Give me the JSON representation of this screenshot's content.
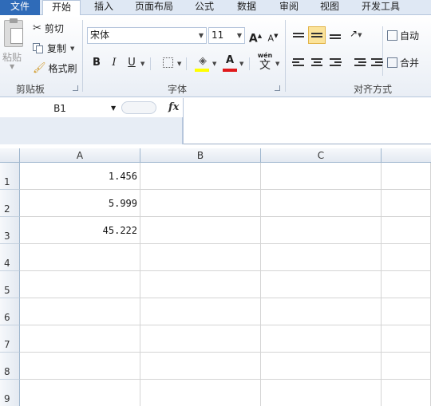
{
  "tabs": [
    {
      "label": "文件",
      "active": false
    },
    {
      "label": "开始",
      "active": true
    },
    {
      "label": "插入",
      "active": false
    },
    {
      "label": "页面布局",
      "active": false
    },
    {
      "label": "公式",
      "active": false
    },
    {
      "label": "数据",
      "active": false
    },
    {
      "label": "审阅",
      "active": false
    },
    {
      "label": "视图",
      "active": false
    },
    {
      "label": "开发工具",
      "active": false
    }
  ],
  "clipboard": {
    "paste_label": "粘贴",
    "cut_label": "剪切",
    "copy_label": "复制",
    "format_painter_label": "格式刷",
    "group_label": "剪贴板"
  },
  "font": {
    "font_name": "宋体",
    "font_size": "11",
    "bold_label": "B",
    "italic_label": "I",
    "underline_label": "U",
    "font_color_letter": "A",
    "phonetic_label": "wén",
    "phonetic_char": "文",
    "group_label": "字体",
    "font_color": "#e0191b",
    "fill_color": "#ffff00"
  },
  "alignment": {
    "wrap_text_label": "自动",
    "merge_label": "合并",
    "group_label": "对齐方式"
  },
  "formula_bar": {
    "name_box": "B1",
    "fx_label": "fx",
    "formula": ""
  },
  "grid": {
    "columns": [
      "A",
      "B",
      "C"
    ],
    "rows": [
      {
        "number": "1",
        "A": "1.456",
        "B": "",
        "C": ""
      },
      {
        "number": "2",
        "A": "5.999",
        "B": "",
        "C": ""
      },
      {
        "number": "3",
        "A": "45.222",
        "B": "",
        "C": ""
      },
      {
        "number": "4",
        "A": "",
        "B": "",
        "C": ""
      },
      {
        "number": "5",
        "A": "",
        "B": "",
        "C": ""
      },
      {
        "number": "6",
        "A": "",
        "B": "",
        "C": ""
      },
      {
        "number": "7",
        "A": "",
        "B": "",
        "C": ""
      },
      {
        "number": "8",
        "A": "",
        "B": "",
        "C": ""
      },
      {
        "number": "9",
        "A": "",
        "B": "",
        "C": ""
      }
    ]
  }
}
